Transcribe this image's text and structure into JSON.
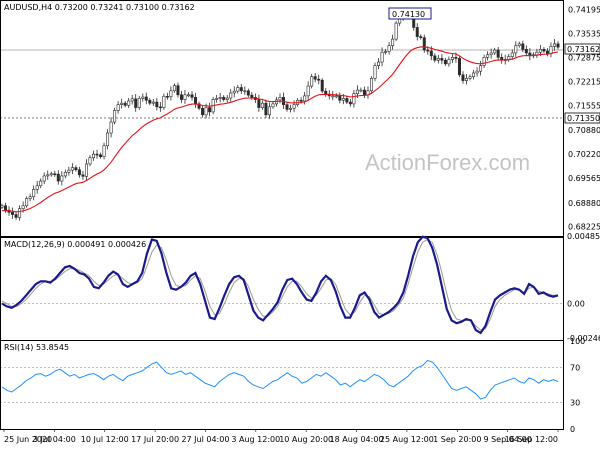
{
  "colors": {
    "candle": "#2a2a2a",
    "ma": "#e0141b",
    "macd": "#1a1a8c",
    "signal": "#9a9a9a",
    "rsi": "#1e90ff",
    "dotted": "#9a9a9a",
    "frame": "#000000"
  },
  "watermark": "ActionForex.com",
  "chart_data": [
    {
      "type": "candlestick",
      "title": "AUDUSD,H4  0.73200 0.73241 0.73100 0.73162",
      "ylim": [
        0.6797,
        0.744
      ],
      "y_ticks": [
        "0.74195",
        "0.73535",
        "0.72875",
        "0.72215",
        "0.71555",
        "0.70880",
        "0.70220",
        "0.69565",
        "0.68880",
        "0.68225"
      ],
      "price_tags": [
        "0.73162",
        "0.71350"
      ],
      "annotation": "0.74130",
      "x_ticks": [
        "25 Jun 2020",
        "3 Jul 04:00",
        "10 Jul 12:00",
        "17 Jul 20:00",
        "27 Jul 04:00",
        "3 Aug 12:00",
        "10 Aug 20:00",
        "18 Aug 04:00",
        "25 Aug 12:00",
        "1 Sep 20:00",
        "9 Sep 04:00",
        "16 Sep 12:00"
      ],
      "close": [
        0.688,
        0.6868,
        0.6862,
        0.6856,
        0.6848,
        0.6872,
        0.688,
        0.69,
        0.6905,
        0.6925,
        0.6935,
        0.6948,
        0.6962,
        0.6965,
        0.6968,
        0.6967,
        0.6948,
        0.6962,
        0.6972,
        0.6978,
        0.6985,
        0.6979,
        0.6965,
        0.6961,
        0.6995,
        0.7012,
        0.7022,
        0.702,
        0.7015,
        0.7045,
        0.708,
        0.711,
        0.7142,
        0.7158,
        0.7162,
        0.7156,
        0.7168,
        0.7174,
        0.715,
        0.7175,
        0.7179,
        0.717,
        0.7162,
        0.7165,
        0.7152,
        0.715,
        0.7181,
        0.718,
        0.7196,
        0.721,
        0.7185,
        0.7172,
        0.7185,
        0.7185,
        0.7178,
        0.716,
        0.7148,
        0.713,
        0.715,
        0.7138,
        0.7172,
        0.7175,
        0.7178,
        0.7172,
        0.7176,
        0.719,
        0.7195,
        0.7205,
        0.7196,
        0.7196,
        0.7184,
        0.7178,
        0.7172,
        0.715,
        0.7162,
        0.713,
        0.7152,
        0.716,
        0.7171,
        0.7178,
        0.7158,
        0.7145,
        0.7148,
        0.7158,
        0.717,
        0.7168,
        0.7182,
        0.7209,
        0.7235,
        0.7228,
        0.7225,
        0.7195,
        0.7187,
        0.7182,
        0.7182,
        0.7182,
        0.717,
        0.7175,
        0.7165,
        0.716,
        0.7188,
        0.7198,
        0.7198,
        0.7185,
        0.7196,
        0.723,
        0.7265,
        0.7275,
        0.7302,
        0.7304,
        0.732,
        0.7338,
        0.7382,
        0.7398,
        0.7412,
        0.7412,
        0.7405,
        0.737,
        0.7345,
        0.7342,
        0.7308,
        0.7305,
        0.7292,
        0.728,
        0.7285,
        0.728,
        0.727,
        0.7282,
        0.7288,
        0.7285,
        0.724,
        0.7224,
        0.723,
        0.7235,
        0.7245,
        0.725,
        0.7265,
        0.7288,
        0.7295,
        0.73,
        0.7308,
        0.7288,
        0.728,
        0.7282,
        0.729,
        0.73,
        0.732,
        0.7325,
        0.731,
        0.73,
        0.7292,
        0.7295,
        0.7302,
        0.731,
        0.7305,
        0.7298,
        0.7318,
        0.7325,
        0.7316
      ],
      "ma_series": "moving average (red line)"
    },
    {
      "type": "line",
      "title": "MACD(12,26,9) 0.000491 0.000426",
      "y_ticks": [
        "0.004854",
        "0.00",
        "-0.002465"
      ],
      "ylim": [
        -0.002465,
        0.004854
      ],
      "macd": [
        0.0,
        -0.0002,
        -0.0003,
        -0.0001,
        0.0002,
        0.0006,
        0.001,
        0.0014,
        0.0016,
        0.0016,
        0.0015,
        0.0018,
        0.0022,
        0.0026,
        0.0027,
        0.0025,
        0.0022,
        0.0021,
        0.0018,
        0.0012,
        0.0011,
        0.0015,
        0.002,
        0.0023,
        0.0021,
        0.0014,
        0.0012,
        0.0014,
        0.0016,
        0.0022,
        0.0036,
        0.0046,
        0.0045,
        0.0036,
        0.0022,
        0.0011,
        0.001,
        0.0012,
        0.0015,
        0.002,
        0.0022,
        0.0014,
        0.0002,
        -0.001,
        -0.0011,
        -0.0003,
        0.0006,
        0.0014,
        0.0019,
        0.002,
        0.0017,
        0.0006,
        -0.0005,
        -0.001,
        -0.0012,
        -0.0008,
        -0.0004,
        0.0001,
        0.001,
        0.0017,
        0.0018,
        0.0014,
        0.0008,
        0.0003,
        0.0002,
        0.0008,
        0.0016,
        0.002,
        0.0017,
        0.0009,
        -0.0002,
        -0.001,
        -0.001,
        -0.0003,
        0.0006,
        0.0008,
        0.0003,
        -0.0006,
        -0.001,
        -0.0008,
        -0.0006,
        -0.0003,
        0.0001,
        0.0008,
        0.002,
        0.0034,
        0.0044,
        0.0048,
        0.0047,
        0.004,
        0.0028,
        0.0012,
        -0.0004,
        -0.0012,
        -0.0014,
        -0.0013,
        -0.0011,
        -0.0012,
        -0.0019,
        -0.0021,
        -0.0016,
        -0.0006,
        0.0003,
        0.0006,
        0.0008,
        0.001,
        0.0011,
        0.001,
        0.0007,
        0.0014,
        0.0012,
        0.0007,
        0.0008,
        0.0006,
        0.0005,
        0.0006
      ],
      "signal": [
        0.0002,
        0.0,
        -0.0002,
        -0.0002,
        0.0,
        0.0003,
        0.0007,
        0.0011,
        0.0014,
        0.0016,
        0.0016,
        0.0017,
        0.002,
        0.0023,
        0.0025,
        0.0025,
        0.0024,
        0.0022,
        0.002,
        0.0016,
        0.0013,
        0.0014,
        0.0017,
        0.002,
        0.0021,
        0.0018,
        0.0015,
        0.0014,
        0.0015,
        0.0018,
        0.0027,
        0.0037,
        0.0042,
        0.004,
        0.0031,
        0.002,
        0.0013,
        0.0012,
        0.0013,
        0.0017,
        0.002,
        0.0018,
        0.0009,
        -0.0002,
        -0.0008,
        -0.0007,
        0.0,
        0.0008,
        0.0015,
        0.0018,
        0.0018,
        0.0012,
        0.0003,
        -0.0004,
        -0.0009,
        -0.0009,
        -0.0006,
        -0.0002,
        0.0005,
        0.0012,
        0.0016,
        0.0016,
        0.0012,
        0.0007,
        0.0004,
        0.0006,
        0.0011,
        0.0017,
        0.0018,
        0.0014,
        0.0005,
        -0.0004,
        -0.0008,
        -0.0006,
        0.0001,
        0.0006,
        0.0005,
        -0.0001,
        -0.0007,
        -0.0008,
        -0.0007,
        -0.0005,
        -0.0001,
        0.0004,
        0.0014,
        0.0026,
        0.0037,
        0.0044,
        0.0046,
        0.0044,
        0.0035,
        0.0022,
        0.0007,
        -0.0005,
        -0.0011,
        -0.0012,
        -0.0012,
        -0.0012,
        -0.0016,
        -0.0019,
        -0.0018,
        -0.0011,
        -0.0002,
        0.0003,
        0.0006,
        0.0008,
        0.001,
        0.001,
        0.0008,
        0.0011,
        0.0012,
        0.0009,
        0.0008,
        0.0007,
        0.0006,
        0.0006
      ]
    },
    {
      "type": "line",
      "title": "RSI(14) 53.8545",
      "y_ticks": [
        "100",
        "70",
        "30",
        "0"
      ],
      "ylim": [
        0,
        100
      ],
      "levels": [
        70,
        30
      ],
      "values": [
        48,
        44,
        42,
        46,
        50,
        55,
        58,
        62,
        63,
        60,
        62,
        66,
        68,
        64,
        60,
        62,
        58,
        60,
        62,
        63,
        60,
        56,
        60,
        62,
        58,
        55,
        60,
        62,
        64,
        66,
        70,
        74,
        76,
        70,
        64,
        62,
        64,
        66,
        62,
        64,
        60,
        56,
        52,
        50,
        48,
        54,
        58,
        62,
        64,
        62,
        60,
        54,
        50,
        48,
        46,
        50,
        54,
        56,
        60,
        64,
        60,
        58,
        52,
        54,
        58,
        62,
        60,
        64,
        60,
        56,
        50,
        52,
        48,
        52,
        56,
        54,
        58,
        62,
        60,
        56,
        50,
        48,
        52,
        56,
        60,
        66,
        70,
        72,
        78,
        76,
        70,
        62,
        54,
        46,
        44,
        46,
        48,
        44,
        40,
        34,
        36,
        44,
        50,
        52,
        54,
        56,
        58,
        54,
        52,
        58,
        56,
        52,
        56,
        54,
        56,
        54
      ]
    }
  ]
}
